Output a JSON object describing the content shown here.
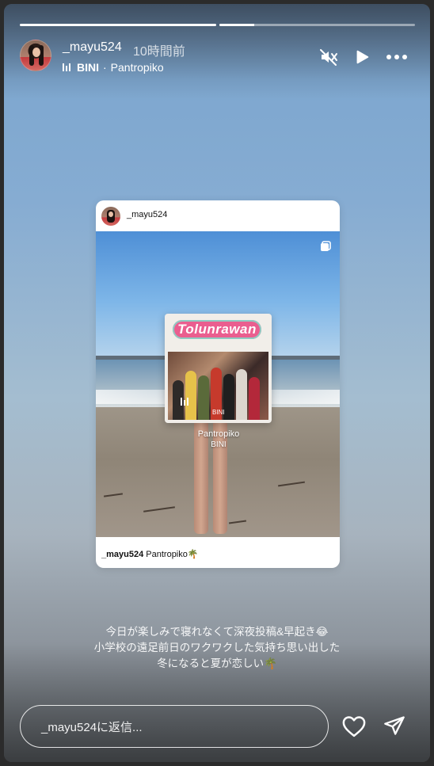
{
  "progress": [
    1.0,
    0.18
  ],
  "header": {
    "username": "_mayu524",
    "time_ago": "10時間前",
    "music_artist": "BINI",
    "music_separator": "·",
    "music_title": "Pantropiko",
    "icons": [
      "mute-icon",
      "play-icon",
      "more-icon"
    ]
  },
  "post": {
    "username": "_mayu524",
    "album_title": "Tolunrawan",
    "album_label": "BINI",
    "song_title": "Pantropiko",
    "song_artist": "BINI",
    "footer_username": "_mayu524",
    "footer_caption": "Pantropiko🌴"
  },
  "caption": {
    "line1": "今日が楽しみで寝れなくて深夜投稿&早起き😂",
    "line2": "小学校の遠足前日のワクワクした気持ち思い出した",
    "line3": "冬になると夏が恋しい🌴"
  },
  "reply": {
    "placeholder": "_mayu524に返信..."
  },
  "colors": {
    "accent": "#ffffff",
    "album_pink": "#ea5e8f"
  }
}
